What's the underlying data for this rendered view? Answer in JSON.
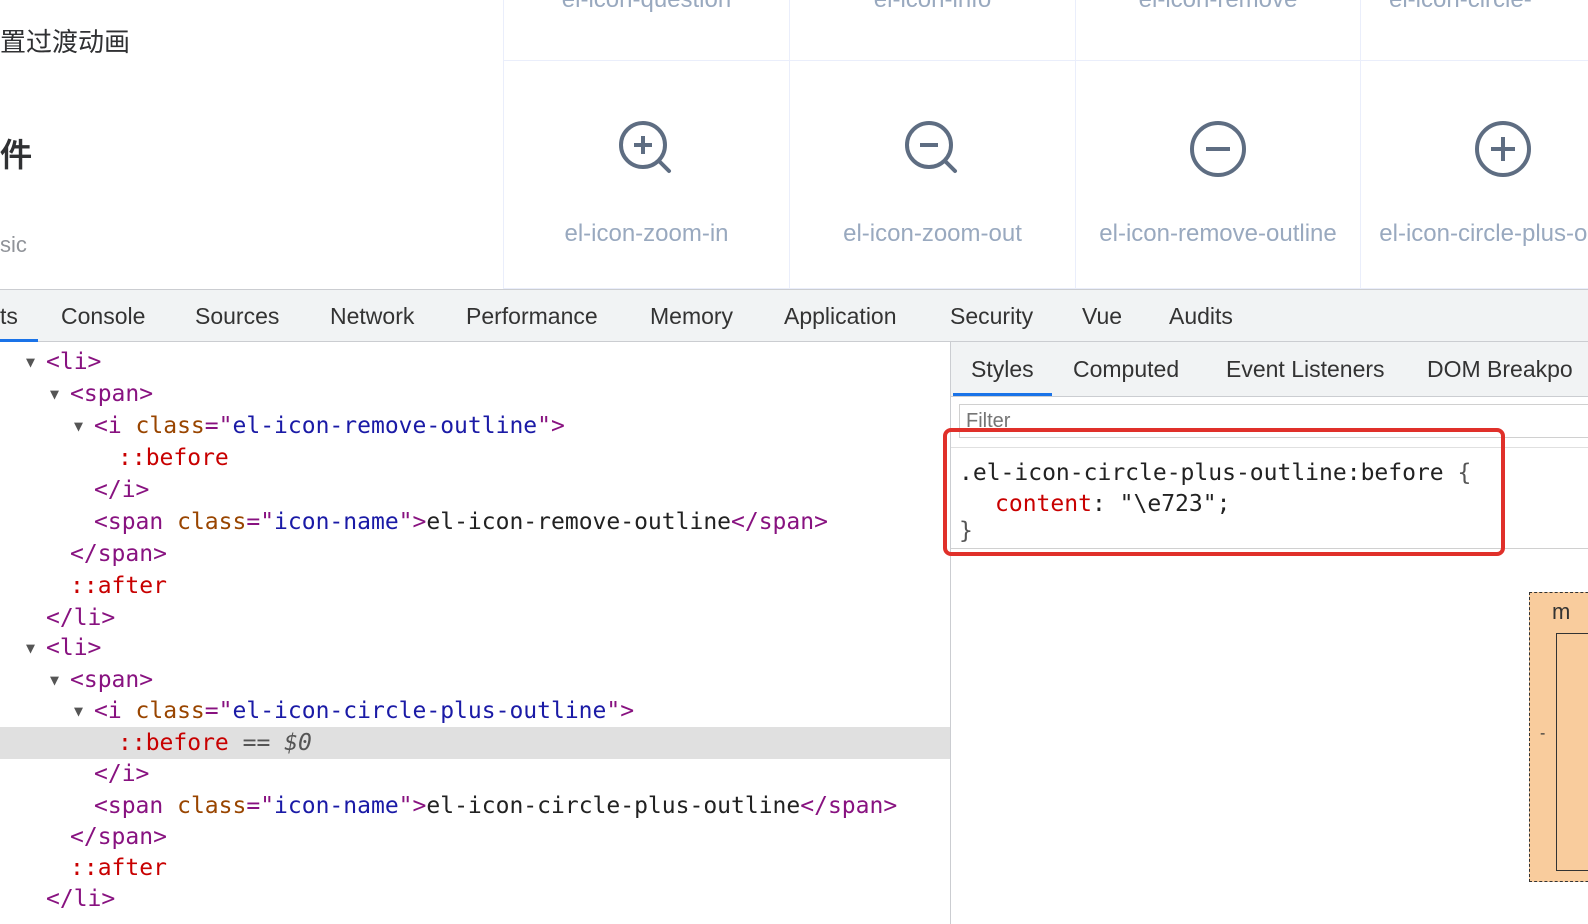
{
  "page": {
    "left_menu": {
      "item1": "置过渡动画",
      "item2": "件",
      "item3": "sic"
    },
    "icon_grid": {
      "row1": [
        "el-icon-question",
        "el-icon-info",
        "el-icon-remove",
        "el-icon-circle-"
      ],
      "row2": [
        {
          "icon": "zoom-in-icon",
          "name": "el-icon-zoom-in"
        },
        {
          "icon": "zoom-out-icon",
          "name": "el-icon-zoom-out"
        },
        {
          "icon": "remove-outline-icon",
          "name": "el-icon-remove-outline"
        },
        {
          "icon": "circle-plus-outline-icon",
          "name": "el-icon-circle-plus-outline"
        }
      ]
    }
  },
  "devtools": {
    "tabs": [
      "ts",
      "Console",
      "Sources",
      "Network",
      "Performance",
      "Memory",
      "Application",
      "Security",
      "Vue",
      "Audits"
    ],
    "elements": {
      "li_open": "<li>",
      "span_open": "<span>",
      "i_open_prefix": "<i ",
      "class_attr": "class",
      "eq_quote": "=\"",
      "close_quote_gt": "\">",
      "class_remove": "el-icon-remove-outline",
      "class_plus": "el-icon-circle-plus-outline",
      "before": "::before",
      "before_eq": "==",
      "before_ref": "$0",
      "i_close": "</i>",
      "span_prefix": "<span ",
      "iconname_val": "icon-name",
      "text_remove": "el-icon-remove-outline",
      "text_plus": "el-icon-circle-plus-outline",
      "span_close": "</span>",
      "after": "::after",
      "li_close": "</li>"
    },
    "styles": {
      "tabs": [
        "Styles",
        "Computed",
        "Event Listeners",
        "DOM Breakpo"
      ],
      "active_tab": "Styles",
      "filter_placeholder": "Filter",
      "rule_selector": ".el-icon-circle-plus-outline:before",
      "open_brace": "{",
      "prop_name": "content",
      "prop_colon": ":",
      "prop_value": "\"\\e723\";",
      "close_brace": "}",
      "box_model_label": "m",
      "box_model_dash": "-"
    },
    "colors": {
      "highlight": "#e0302a",
      "active_tab_underline": "#1a73e8",
      "tag": "#881280",
      "attr_name": "#994500",
      "attr_value": "#1a1aa6",
      "pseudo": "#c80000"
    }
  }
}
